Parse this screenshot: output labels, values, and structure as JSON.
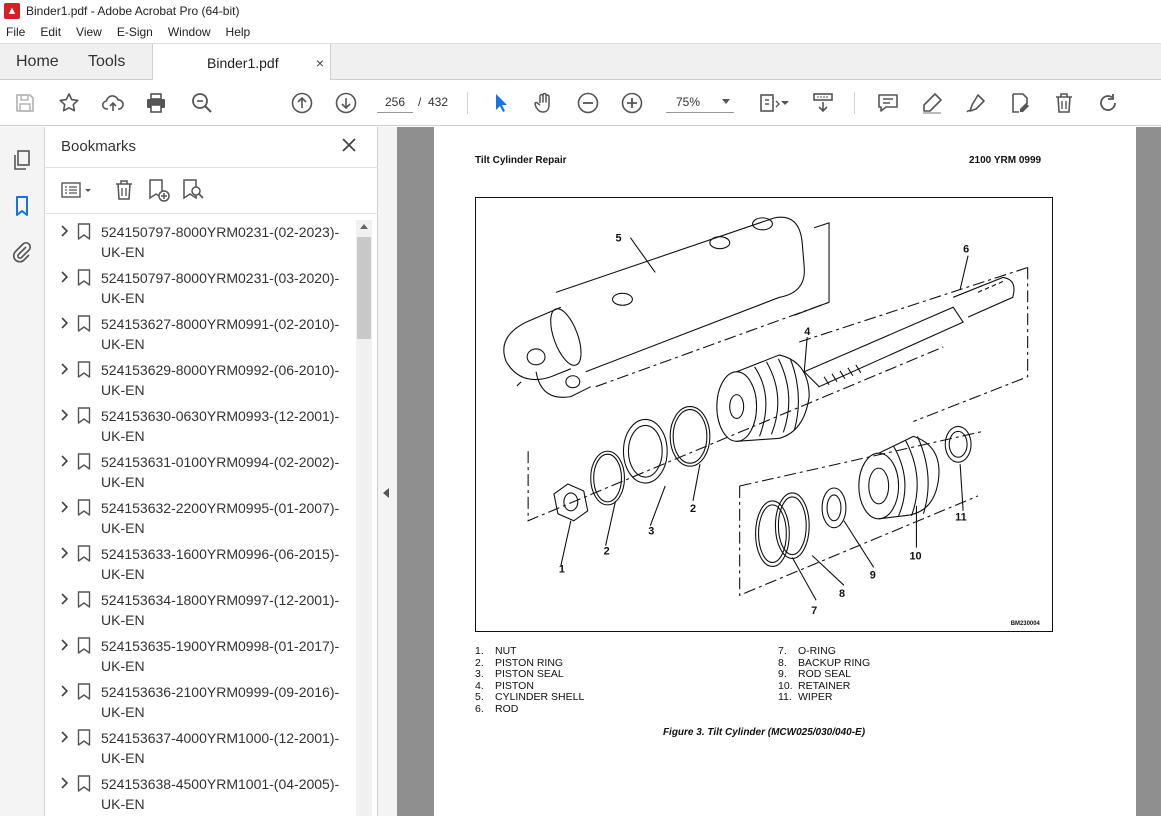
{
  "window": {
    "title": "Binder1.pdf - Adobe Acrobat Pro (64-bit)"
  },
  "menu": [
    "File",
    "Edit",
    "View",
    "E-Sign",
    "Window",
    "Help"
  ],
  "tabs": {
    "home": "Home",
    "tools": "Tools",
    "document": "Binder1.pdf",
    "close_glyph": "×"
  },
  "toolbar": {
    "page_current": "256",
    "page_separator": "/",
    "page_total": "432",
    "zoom": "75%"
  },
  "sidebar": {
    "title": "Bookmarks",
    "bookmarks": [
      "524150797-8000YRM0231-(02-2023)-UK-EN",
      "524150797-8000YRM0231-(03-2020)-UK-EN",
      "524153627-8000YRM0991-(02-2010)-UK-EN",
      "524153629-8000YRM0992-(06-2010)-UK-EN",
      "524153630-0630YRM0993-(12-2001)-UK-EN",
      "524153631-0100YRM0994-(02-2002)-UK-EN",
      "524153632-2200YRM0995-(01-2007)-UK-EN",
      "524153633-1600YRM0996-(06-2015)-UK-EN",
      "524153634-1800YRM0997-(12-2001)-UK-EN",
      "524153635-1900YRM0998-(01-2017)-UK-EN",
      "524153636-2100YRM0999-(09-2016)-UK-EN",
      "524153637-4000YRM1000-(12-2001)-UK-EN",
      "524153638-4500YRM1001-(04-2005)-UK-EN"
    ]
  },
  "document": {
    "header_left": "Tilt Cylinder Repair",
    "header_right": "2100 YRM 0999",
    "figure_code": "BM230004",
    "callouts": [
      "1",
      "2",
      "2",
      "3",
      "4",
      "5",
      "6",
      "7",
      "8",
      "9",
      "10",
      "11"
    ],
    "legend_left": [
      {
        "num": "1.",
        "text": "NUT"
      },
      {
        "num": "2.",
        "text": "PISTON RING"
      },
      {
        "num": "3.",
        "text": "PISTON SEAL"
      },
      {
        "num": "4.",
        "text": "PISTON"
      },
      {
        "num": "5.",
        "text": "CYLINDER SHELL"
      },
      {
        "num": "6.",
        "text": "ROD"
      }
    ],
    "legend_right": [
      {
        "num": "7.",
        "text": "O-RING"
      },
      {
        "num": "8.",
        "text": "BACKUP RING"
      },
      {
        "num": "9.",
        "text": "ROD SEAL"
      },
      {
        "num": "10.",
        "text": "RETAINER"
      },
      {
        "num": "11.",
        "text": "WIPER"
      }
    ],
    "caption": "Figure 3. Tilt Cylinder (MCW025/030/040-E)"
  },
  "colors": {
    "accent": "#1473e6",
    "rail_active": "#1473e6",
    "doc_bg": "#8f8f8f"
  }
}
